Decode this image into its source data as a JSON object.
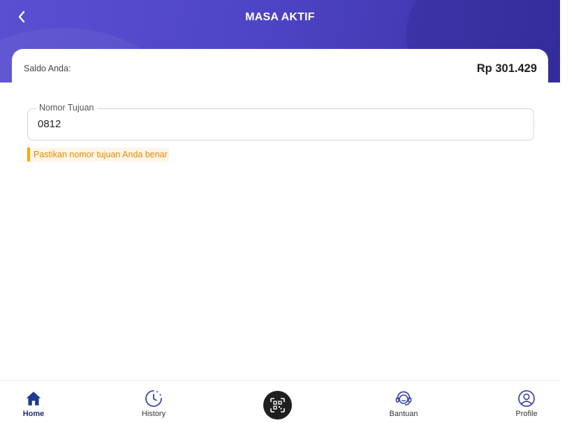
{
  "header": {
    "title": "MASA AKTIF"
  },
  "saldo": {
    "label": "Saldo Anda:",
    "value": "Rp 301.429"
  },
  "form": {
    "nomor_label": "Nomor Tujuan",
    "nomor_value": "0812",
    "warning": "Pastikan nomor tujuan Anda benar"
  },
  "nav": {
    "items": [
      {
        "label": "Home",
        "icon": "home-icon",
        "active": true
      },
      {
        "label": "History",
        "icon": "clock-icon",
        "active": false
      },
      {
        "label": "",
        "icon": "qr-scan-icon",
        "active": false
      },
      {
        "label": "Bantuan",
        "icon": "support-agent-icon",
        "active": false
      },
      {
        "label": "Profile",
        "icon": "user-icon",
        "active": false
      }
    ]
  },
  "colors": {
    "header_start": "#5a4fd0",
    "header_end": "#3a31a5",
    "warning_accent": "#f7a800",
    "warning_text": "#e48a00",
    "nav_active": "#1f2b6f",
    "nav_icon": "#3a44a8"
  }
}
